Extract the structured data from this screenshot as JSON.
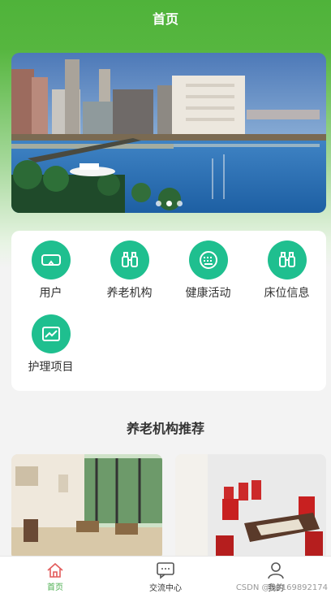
{
  "navbar": {
    "title": "首页"
  },
  "banner": {
    "slide_count": 3,
    "active_index": 1
  },
  "menu": {
    "items": [
      {
        "label": "用户",
        "icon": "vr-goggles-icon"
      },
      {
        "label": "养老机构",
        "icon": "binoculars-icon"
      },
      {
        "label": "健康活动",
        "icon": "keyboard-icon"
      },
      {
        "label": "床位信息",
        "icon": "binoculars-icon"
      },
      {
        "label": "护理项目",
        "icon": "image-icon"
      }
    ]
  },
  "recommend": {
    "title": "养老机构推荐"
  },
  "tabbar": {
    "items": [
      {
        "label": "首页",
        "icon": "home-icon",
        "active": true
      },
      {
        "label": "交流中心",
        "icon": "chat-icon",
        "active": false
      },
      {
        "label": "我的",
        "icon": "user-icon",
        "active": false
      }
    ]
  },
  "watermark": "CSDN @Q3169892174",
  "colors": {
    "primary": "#4fb33a",
    "icon_bg": "#1fbf8f",
    "tab_active": "#4caf50"
  }
}
